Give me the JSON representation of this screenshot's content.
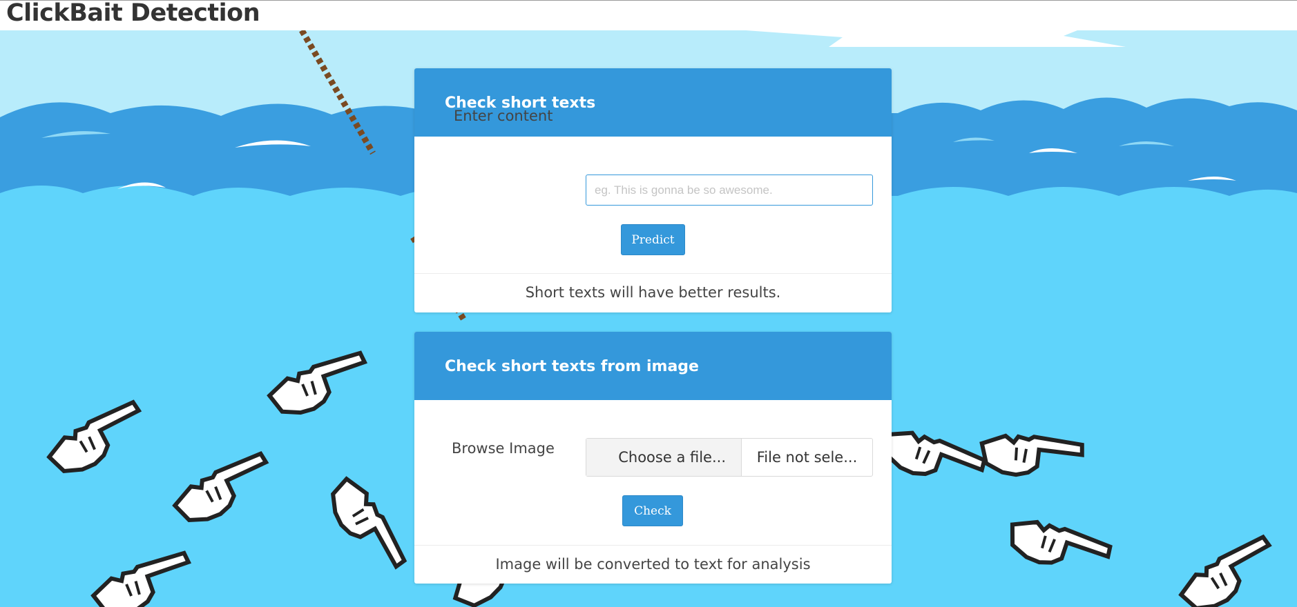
{
  "app": {
    "title": "ClickBait Detection"
  },
  "text_card": {
    "title": "Check short texts",
    "field_label": "Enter content",
    "input_value": "",
    "input_placeholder": "eg. This is gonna be so awesome.",
    "button_label": "Predict",
    "footer": "Short texts will have better results."
  },
  "image_card": {
    "title": "Check short texts from image",
    "field_label": "Browse Image",
    "file_button_label": "Choose a file...",
    "file_status": "File not sele...",
    "button_label": "Check",
    "footer": "Image will be converted to text for analysis"
  },
  "colors": {
    "accent": "#3498db",
    "sky": "#b8ecfb",
    "sea": "#5fd4fb",
    "wave": "#3a9ee0"
  }
}
